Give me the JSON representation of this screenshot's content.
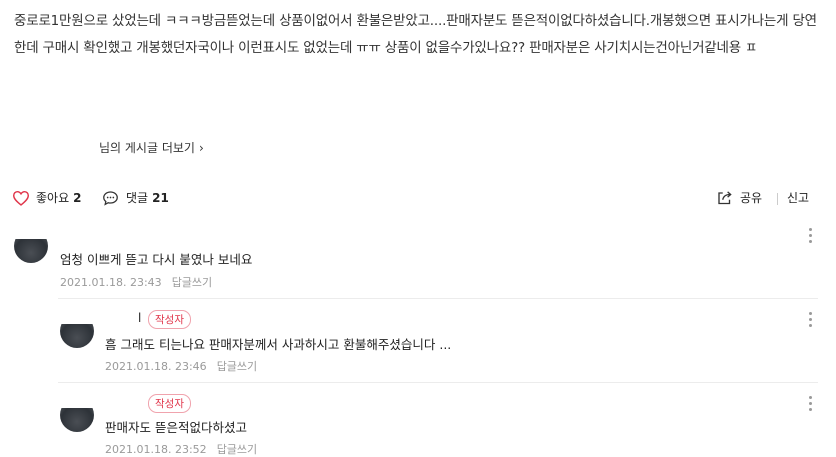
{
  "post": {
    "body": "중로로1만원으로 샀었는데 ㅋㅋㅋ방금뜯었는데 상품이없어서 환불은받았고....판매자분도 뜯은적이없다하셨습니다.개봉했으면 표시가나는게 당연한데 구매시 확인했고 개봉했던자국이나 이런표시도 없었는데 ㅠㅠ 상품이 없을수가있나요?? 판매자분은 사기치시는건아닌거같네용 ㅍ",
    "more_link": "님의 게시글 더보기"
  },
  "actions": {
    "like_label": "좋아요",
    "like_count": "2",
    "comment_label": "댓글",
    "comment_count": "21",
    "share_label": "공유",
    "report_label": "신고"
  },
  "comments": [
    {
      "text": "엄청 이쁘게 뜯고 다시 붙였나 보네요",
      "date": "2021.01.18. 23:43",
      "reply": "답글쓰기"
    },
    {
      "nickname": "l",
      "badge": "작성자",
      "text": "흠 그래도 티는나요 판매자분께서 사과하시고 환불해주셨습니다 ...",
      "date": "2021.01.18. 23:46",
      "reply": "답글쓰기"
    },
    {
      "badge": "작성자",
      "text": "판매자도 뜯은적없다하셨고",
      "date": "2021.01.18. 23:52",
      "reply": "답글쓰기"
    }
  ],
  "colors": {
    "heart": "#e0364b",
    "author_badge": "#e0364b",
    "meta_text": "#9a9a9a"
  },
  "icons": [
    "heart-icon",
    "comment-bubble-icon",
    "share-icon",
    "chevron-right-icon",
    "more-options-icon"
  ]
}
